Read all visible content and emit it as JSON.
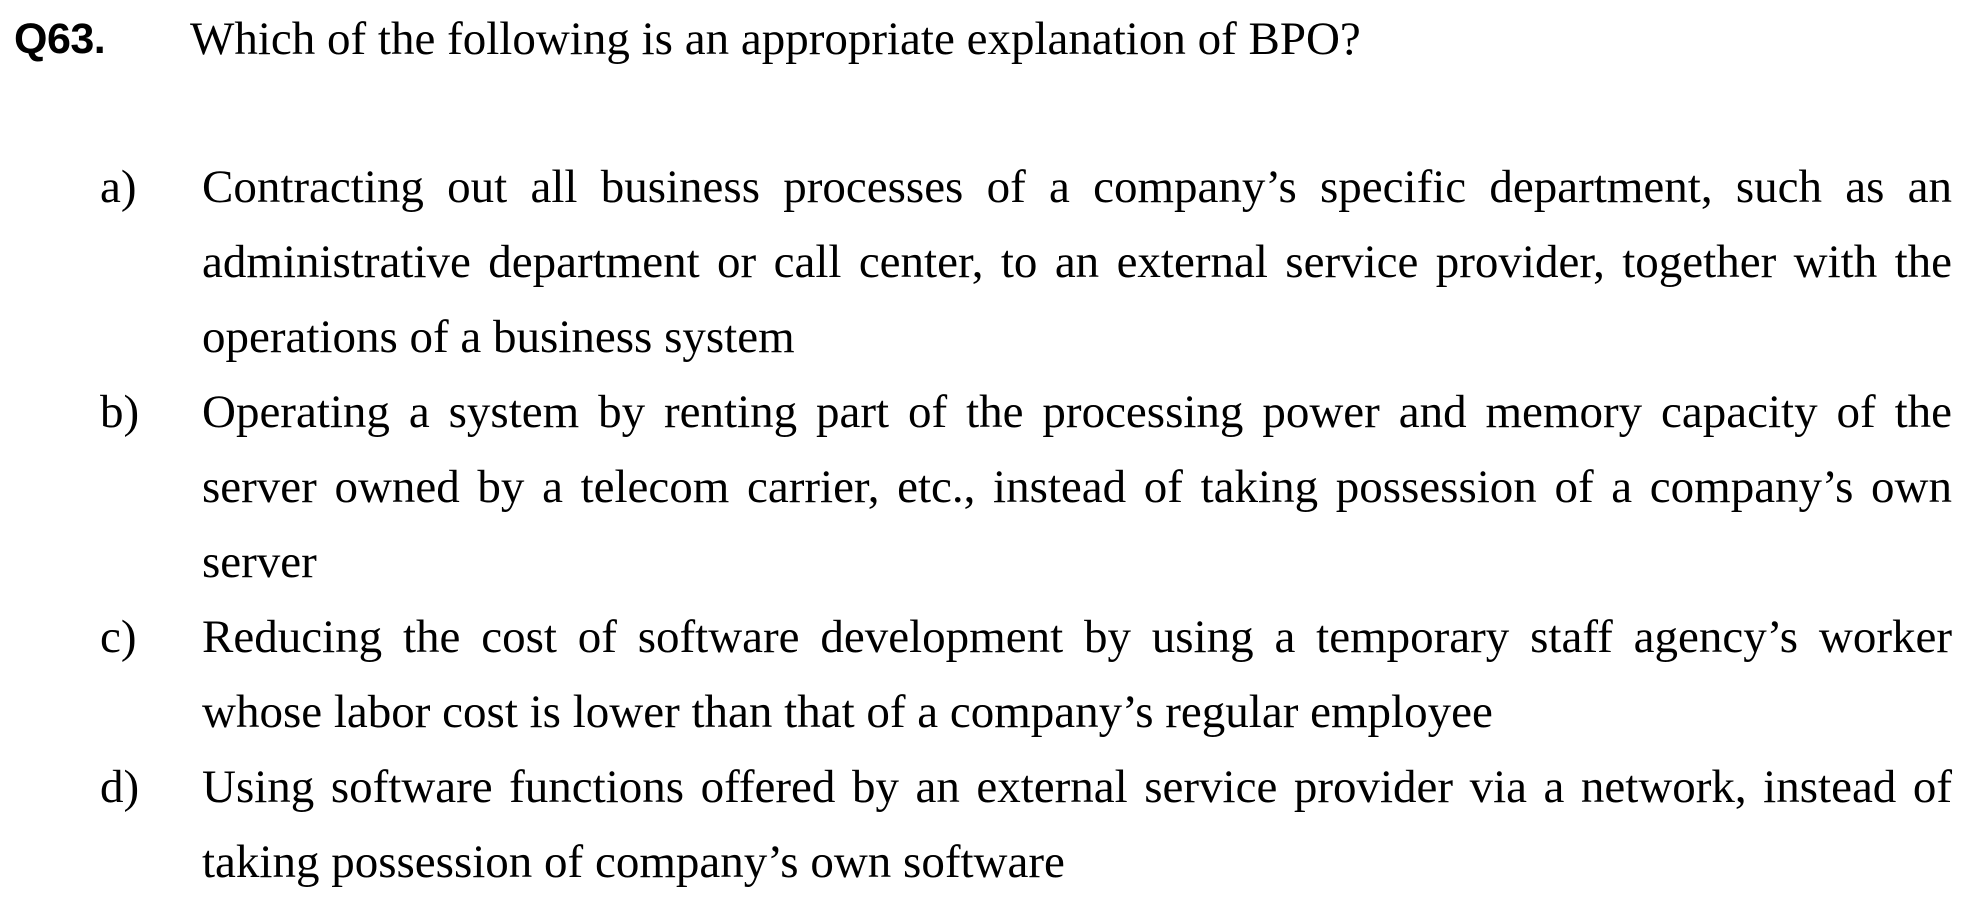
{
  "question": {
    "number": "Q63.",
    "text": "Which of the following is an appropriate explanation of BPO?"
  },
  "options": [
    {
      "letter": "a)",
      "text": "Contracting out all business processes of a company’s specific department, such as an administrative department or call center, to an external service provider, together with the operations of a business system"
    },
    {
      "letter": "b)",
      "text": "Operating a system by renting part of the processing power and memory capacity of the server owned by a telecom carrier, etc., instead of taking possession of a company’s own server"
    },
    {
      "letter": "c)",
      "text": "Reducing the cost of software development by using a temporary staff agency’s worker whose labor cost is lower than that of a company’s regular employee"
    },
    {
      "letter": "d)",
      "text": "Using software functions offered by an external service provider via a network, instead of taking possession of company’s own software"
    }
  ]
}
